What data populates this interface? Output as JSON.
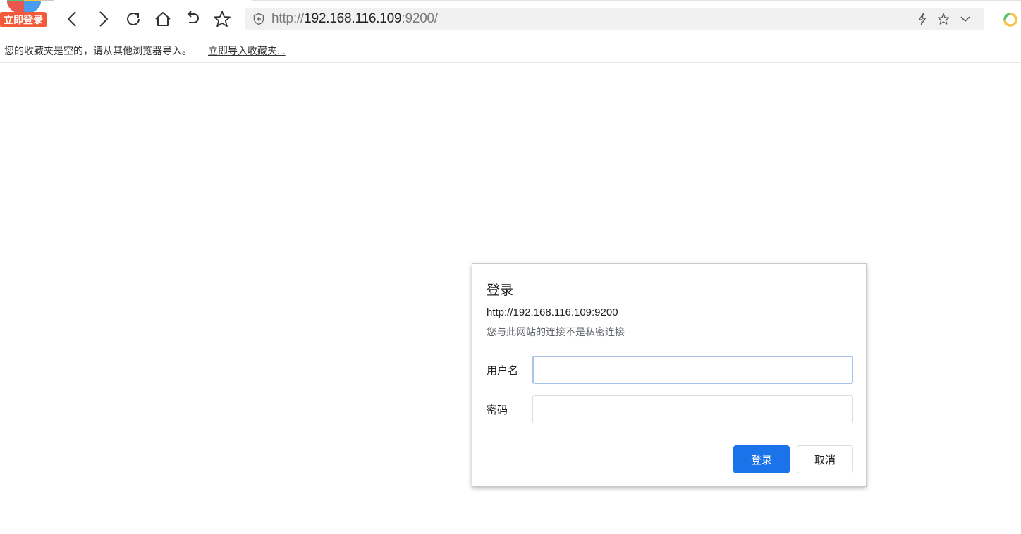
{
  "browser": {
    "logo_badge": "立即登录",
    "toolbar_icons": [
      "back-icon",
      "forward-icon",
      "reload-icon",
      "home-icon",
      "undo-icon",
      "star-icon"
    ],
    "address_bar": {
      "scheme": "http://",
      "host": "192.168.116.109",
      "rest": ":9200/",
      "security_icon": "shield-icon",
      "right_icons": [
        "lightning-icon",
        "star-icon",
        "chevron-down-icon"
      ]
    },
    "extension_icon": "extension-icon"
  },
  "bookmarks_bar": {
    "message": "您的收藏夹是空的，请从其他浏览器导入。",
    "import_link": "立即导入收藏夹..."
  },
  "auth_dialog": {
    "title": "登录",
    "origin": "http://192.168.116.109:9200",
    "warning": "您与此网站的连接不是私密连接",
    "username_label": "用户名",
    "username_value": "",
    "password_label": "密码",
    "password_value": "",
    "login_button": "登录",
    "cancel_button": "取消"
  },
  "colors": {
    "primary": "#1a73e8",
    "badge": "#f25a3a",
    "focus_border": "#a8c4ee"
  }
}
